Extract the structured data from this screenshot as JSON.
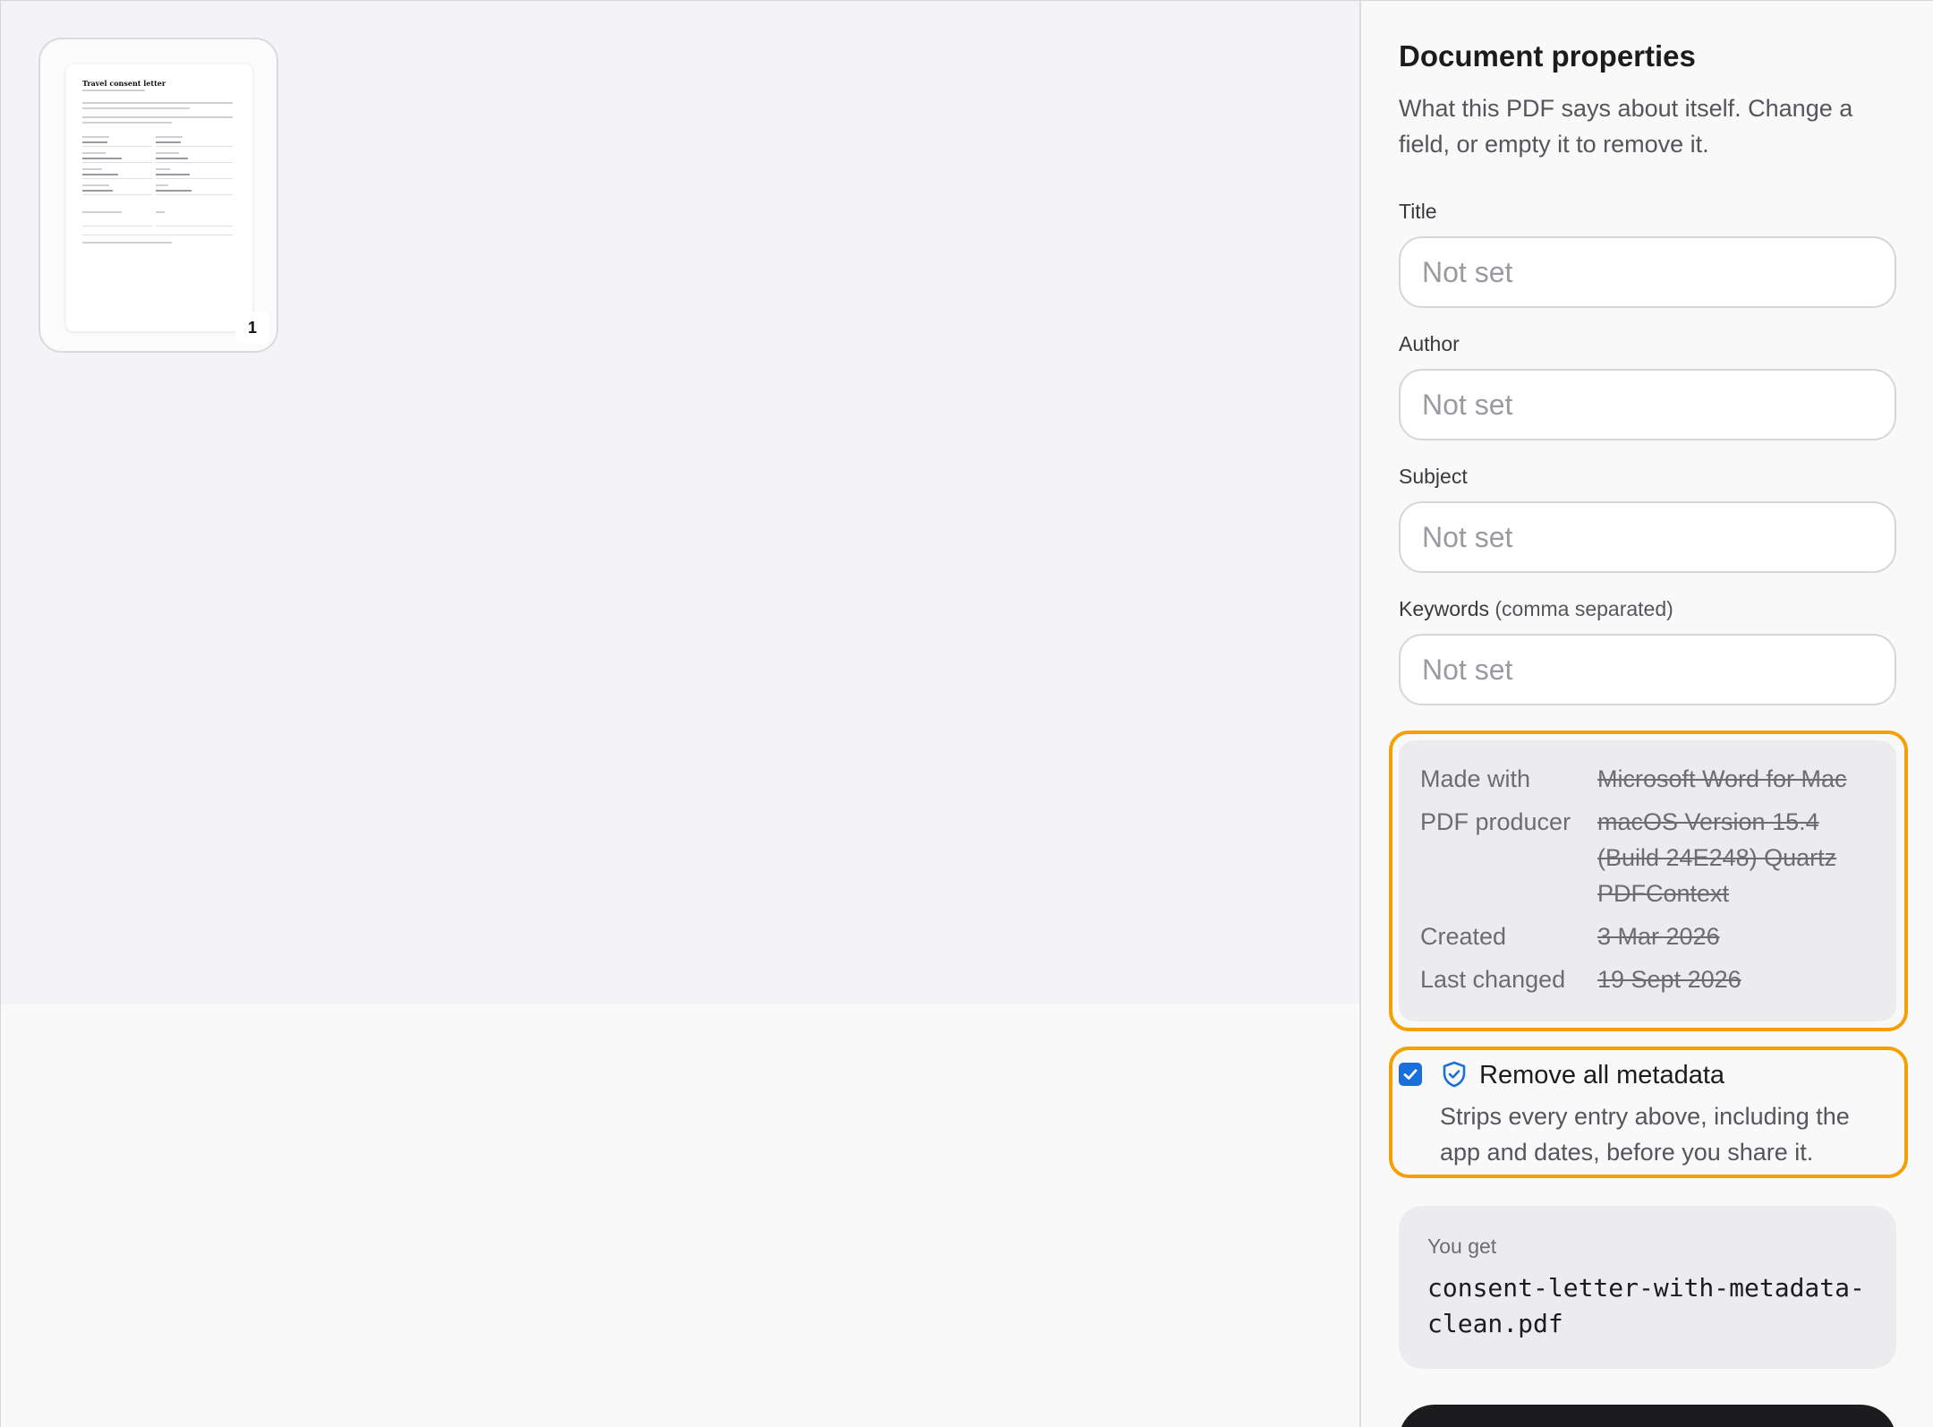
{
  "thumbnail": {
    "page_number": "1",
    "page_title": "Travel consent letter"
  },
  "panel": {
    "title": "Document properties",
    "description": "What this PDF says about itself. Change a field, or empty it to remove it.",
    "fields": {
      "title": {
        "label": "Title",
        "placeholder": "Not set",
        "value": ""
      },
      "author": {
        "label": "Author",
        "placeholder": "Not set",
        "value": ""
      },
      "subject": {
        "label": "Subject",
        "placeholder": "Not set",
        "value": ""
      },
      "keywords": {
        "label": "Keywords",
        "hint": "(comma separated)",
        "placeholder": "Not set",
        "value": ""
      }
    },
    "metadata": {
      "made_with_label": "Made with",
      "made_with_value": "Microsoft Word for Mac",
      "producer_label": "PDF producer",
      "producer_value": "macOS Version 15.4 (Build 24E248) Quartz PDFContext",
      "created_label": "Created",
      "created_value": "3 Mar 2026",
      "changed_label": "Last changed",
      "changed_value": "19 Sept 2026"
    },
    "remove_all": {
      "checked": true,
      "label": "Remove all metadata",
      "description": "Strips every entry above, including the app and dates, before you share it."
    },
    "output": {
      "label": "You get",
      "filename": "consent-letter-with-metadata-clean.pdf"
    },
    "colors": {
      "highlight": "#f5a000",
      "accent": "#1a6fdc",
      "button": "#1c1c1e"
    }
  }
}
